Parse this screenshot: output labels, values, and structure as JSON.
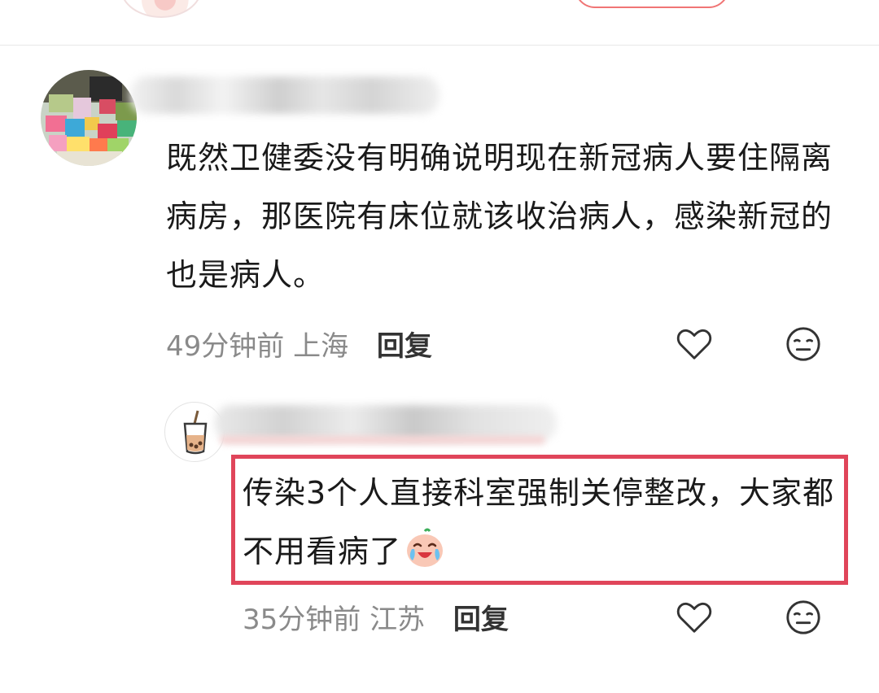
{
  "comments": [
    {
      "text": "既然卫健委没有明确说明现在新冠病人要住隔离病房，那医院有床位就该收治病人，感染新冠的也是病人。",
      "time": "49分钟前",
      "location": "上海",
      "reply_label": "回复",
      "like_icon": "heart-outline",
      "reaction_icon": "neutral-face-outline"
    },
    {
      "text": "传染3个人直接科室强制关停整改，大家都不用看病了",
      "emoji": "crying-laughing-face",
      "time": "35分钟前",
      "location": "江苏",
      "reply_label": "回复",
      "like_icon": "heart-outline",
      "reaction_icon": "neutral-face-outline",
      "highlight_color": "#e0455a"
    }
  ]
}
